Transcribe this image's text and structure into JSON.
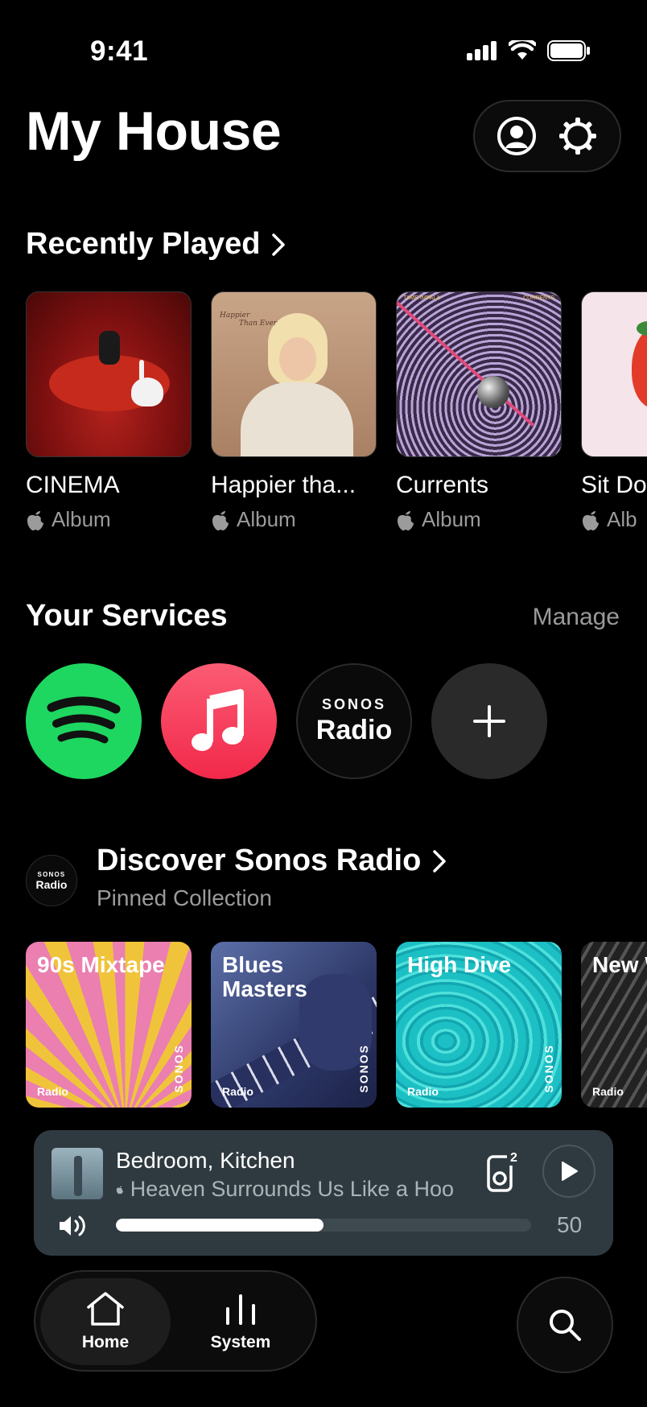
{
  "status_bar": {
    "time": "9:41"
  },
  "header": {
    "title": "My House",
    "icons": [
      "profile-icon",
      "settings-icon"
    ]
  },
  "recently_played": {
    "title": "Recently Played",
    "items": [
      {
        "title": "CINEMA",
        "type": "Album"
      },
      {
        "title": "Happier tha...",
        "type": "Album"
      },
      {
        "title": "Currents",
        "type": "Album"
      },
      {
        "title": "Sit Do",
        "type": "Alb"
      }
    ]
  },
  "services": {
    "title": "Your Services",
    "manage": "Manage",
    "items": [
      {
        "name": "spotify-icon"
      },
      {
        "name": "apple-music-icon"
      },
      {
        "brand": "SONOS",
        "label": "Radio"
      },
      {
        "name": "plus-icon"
      }
    ]
  },
  "discover": {
    "badge_brand": "SONOS",
    "badge_label": "Radio",
    "title": "Discover Sonos Radio",
    "subtitle": "Pinned Collection",
    "items": [
      {
        "name": "90s Mixtape",
        "tag": "Radio",
        "brand": "SONOS"
      },
      {
        "name": "Blues Masters",
        "tag": "Radio",
        "brand": "SONOS"
      },
      {
        "name": "High Dive",
        "tag": "Radio",
        "brand": "SONOS"
      },
      {
        "name": "New Wave",
        "tag": "Radio",
        "brand": ""
      }
    ]
  },
  "now_playing": {
    "rooms": "Bedroom, Kitchen",
    "track": "Heaven Surrounds Us Like a Hoo",
    "group_count": "2",
    "volume_level": "50",
    "volume_fraction": 0.5
  },
  "nav": {
    "home": "Home",
    "system": "System"
  },
  "colors": {
    "spotify": "#1ed760",
    "apple_music": "#f2284a",
    "now_playing_bg": "#2f3a40"
  }
}
